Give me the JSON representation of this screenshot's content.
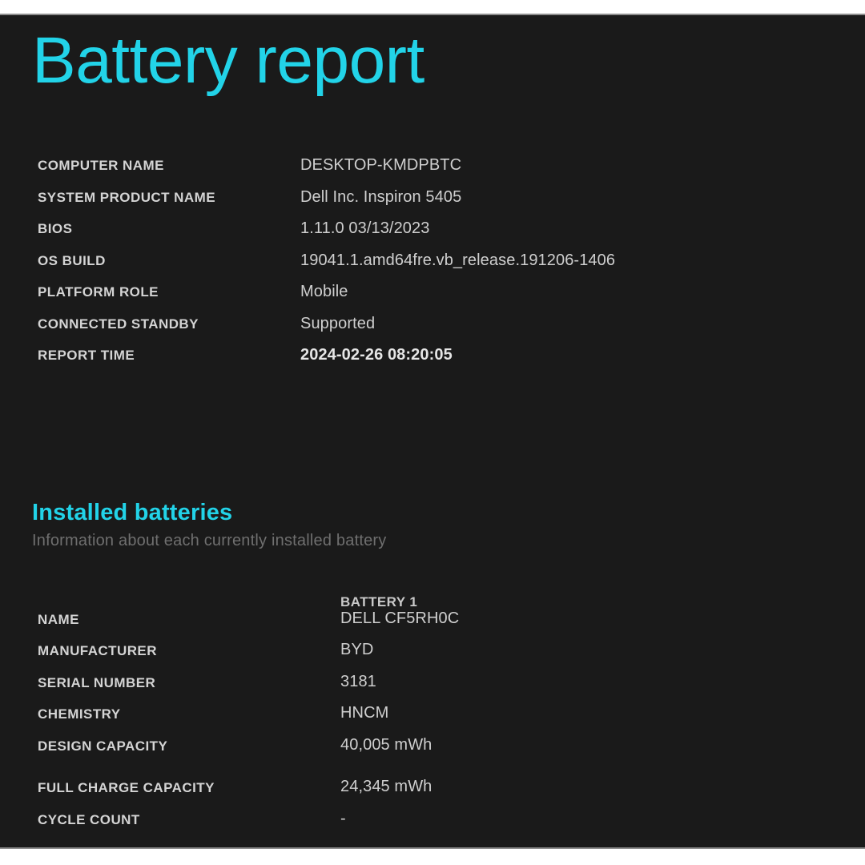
{
  "document": {
    "title": "Battery report",
    "background_color": "#1a1a1a",
    "accent_color": "#22d3e8"
  },
  "system_info": {
    "rows": [
      {
        "label": "COMPUTER NAME",
        "value": "DESKTOP-KMDPBTC"
      },
      {
        "label": "SYSTEM PRODUCT NAME",
        "value": "Dell Inc. Inspiron 5405"
      },
      {
        "label": "BIOS",
        "value": "1.11.0 03/13/2023"
      },
      {
        "label": "OS BUILD",
        "value": "19041.1.amd64fre.vb_release.191206-1406"
      },
      {
        "label": "PLATFORM ROLE",
        "value": "Mobile"
      },
      {
        "label": "CONNECTED STANDBY",
        "value": "Supported"
      },
      {
        "label": "REPORT TIME",
        "value": "2024-02-26  08:20:05"
      }
    ]
  },
  "installed_batteries": {
    "heading": "Installed batteries",
    "subtitle": "Information about each currently installed battery",
    "column_header": "BATTERY 1",
    "rows": [
      {
        "label": "NAME",
        "value": "DELL CF5RH0C"
      },
      {
        "label": "MANUFACTURER",
        "value": "BYD"
      },
      {
        "label": "SERIAL NUMBER",
        "value": "3181"
      },
      {
        "label": "CHEMISTRY",
        "value": "HNCM"
      },
      {
        "label": "DESIGN CAPACITY",
        "value": "40,005 mWh"
      },
      {
        "label": "FULL CHARGE CAPACITY",
        "value": "24,345 mWh"
      },
      {
        "label": "CYCLE COUNT",
        "value": "-"
      }
    ]
  }
}
